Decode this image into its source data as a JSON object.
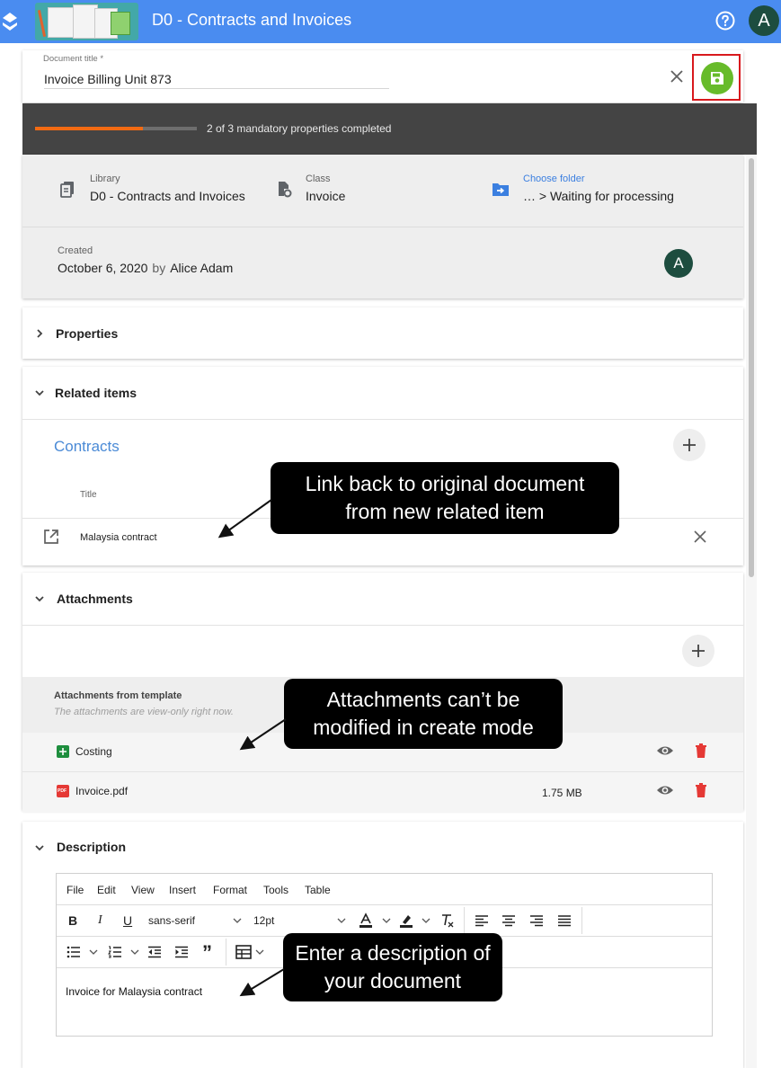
{
  "app": {
    "title": "D0 - Contracts and Invoices",
    "avatar_initial": "A"
  },
  "document": {
    "title_label": "Document title *",
    "title_value": "Invoice Billing Unit 873"
  },
  "progress": {
    "text": "2 of 3 mandatory properties completed",
    "completed": 2,
    "total": 3
  },
  "info": {
    "library_label": "Library",
    "library_value": "D0 - Contracts and Invoices",
    "class_label": "Class",
    "class_value": "Invoice",
    "folder_label": "Choose folder",
    "folder_value": "… >  Waiting for processing",
    "created_label": "Created",
    "created_date": "October 6, 2020",
    "created_by_word": "by",
    "created_by": "Alice Adam",
    "created_avatar": "A"
  },
  "sections": {
    "properties": "Properties",
    "related": "Related items",
    "attachments": "Attachments",
    "description": "Description"
  },
  "related": {
    "group": "Contracts",
    "column_title": "Title",
    "rows": [
      {
        "title": "Malaysia contract"
      }
    ]
  },
  "attachments": {
    "template_title": "Attachments from template",
    "template_subtitle": "The attachments are view-only right now.",
    "files": [
      {
        "name": "Costing",
        "size": ""
      },
      {
        "name": "Invoice.pdf",
        "size": "1.75 MB"
      }
    ],
    "pdf_icon_text": "PDF"
  },
  "editor": {
    "menu": [
      "File",
      "Edit",
      "View",
      "Insert",
      "Format",
      "Tools",
      "Table"
    ],
    "font_family": "sans-serif",
    "font_size": "12pt",
    "content": "Invoice for Malaysia contract"
  },
  "callouts": {
    "link_back": "Link back to original document from new related item",
    "attachments_note": "Attachments can’t be modified in create mode",
    "description_note": "Enter a description of your document"
  },
  "colors": {
    "topbar": "#4a8cf0",
    "progress_fill": "#f26a12",
    "save": "#67bb2a",
    "delete": "#e53935",
    "link": "#3b7fe0"
  }
}
